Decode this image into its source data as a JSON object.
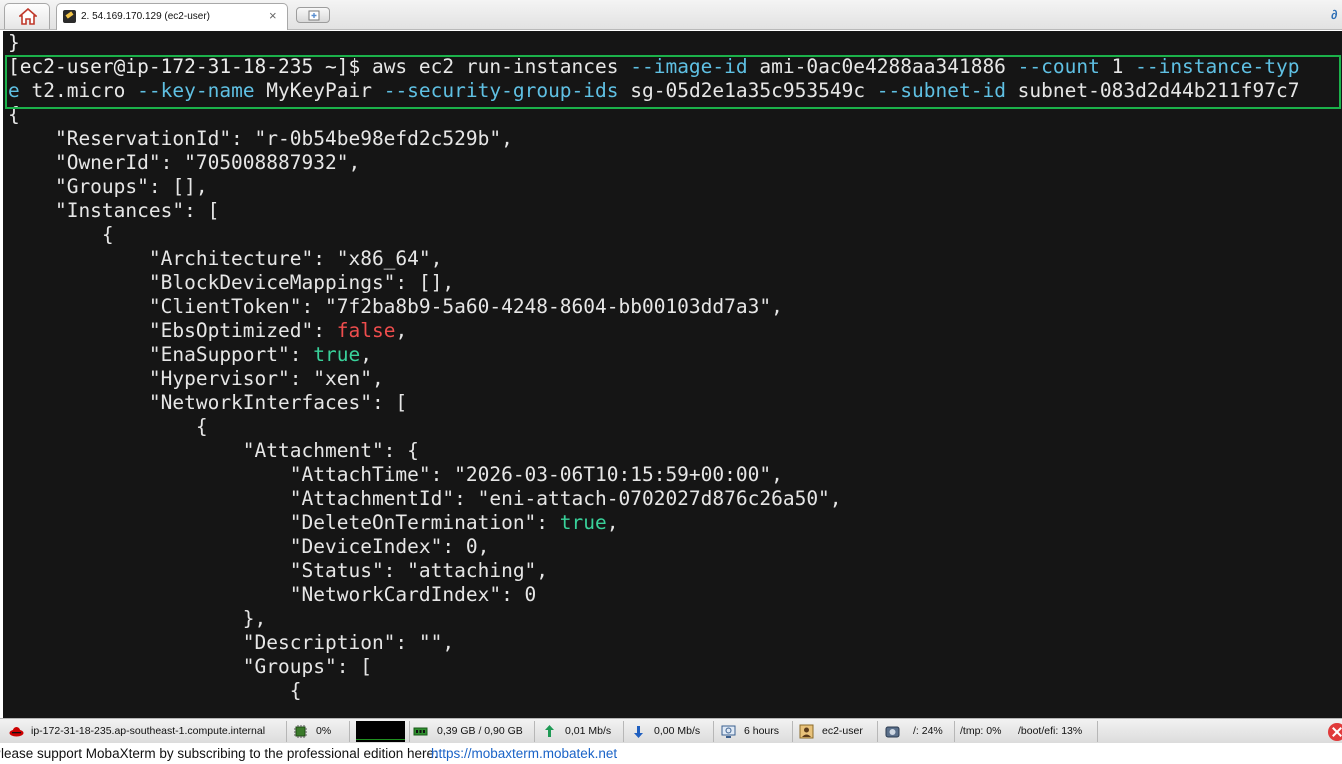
{
  "tabs": {
    "home_icon": "home-icon",
    "session_label": "2. 54.169.170.129 (ec2-user)",
    "close_glyph": "×",
    "new_tab_icon": "add-tab-icon"
  },
  "terminal": {
    "prev_brace": "}",
    "prompt": "[ec2-user@ip-172-31-18-235 ~]$ ",
    "cmd_line1": [
      {
        "text": "aws ec2 run-instances ",
        "kind": "val"
      },
      {
        "text": "--image-id",
        "kind": "flag"
      },
      {
        "text": " ami-0ac0e4288aa341886 ",
        "kind": "val"
      },
      {
        "text": "--count",
        "kind": "flag"
      },
      {
        "text": " 1 ",
        "kind": "val"
      },
      {
        "text": "--instance-typ",
        "kind": "flag"
      }
    ],
    "cmd_line2": [
      {
        "text": "e",
        "kind": "flag"
      },
      {
        "text": " t2.micro ",
        "kind": "val"
      },
      {
        "text": "--key-name",
        "kind": "flag"
      },
      {
        "text": " MyKeyPair ",
        "kind": "val"
      },
      {
        "text": "--security-group-ids",
        "kind": "flag"
      },
      {
        "text": " sg-05d2e1a35c953549c ",
        "kind": "val"
      },
      {
        "text": "--subnet-id",
        "kind": "flag"
      },
      {
        "text": " subnet-083d2d44b211f97c7",
        "kind": "val"
      }
    ],
    "output": [
      [
        {
          "text": "{",
          "kind": "val"
        }
      ],
      [
        {
          "text": "    \"ReservationId\": \"r-0b54be98efd2c529b\",",
          "kind": "val"
        }
      ],
      [
        {
          "text": "    \"OwnerId\": \"705008887932\",",
          "kind": "val"
        }
      ],
      [
        {
          "text": "    \"Groups\": [],",
          "kind": "val"
        }
      ],
      [
        {
          "text": "    \"Instances\": [",
          "kind": "val"
        }
      ],
      [
        {
          "text": "        {",
          "kind": "val"
        }
      ],
      [
        {
          "text": "            \"Architecture\": \"x86_64\",",
          "kind": "val"
        }
      ],
      [
        {
          "text": "            \"BlockDeviceMappings\": [],",
          "kind": "val"
        }
      ],
      [
        {
          "text": "            \"ClientToken\": \"7f2ba8b9-5a60-4248-8604-bb00103dd7a3\",",
          "kind": "val"
        }
      ],
      [
        {
          "text": "            \"EbsOptimized\": ",
          "kind": "val"
        },
        {
          "text": "false",
          "kind": "false"
        },
        {
          "text": ",",
          "kind": "val"
        }
      ],
      [
        {
          "text": "            \"EnaSupport\": ",
          "kind": "val"
        },
        {
          "text": "true",
          "kind": "true"
        },
        {
          "text": ",",
          "kind": "val"
        }
      ],
      [
        {
          "text": "            \"Hypervisor\": \"xen\",",
          "kind": "val"
        }
      ],
      [
        {
          "text": "            \"NetworkInterfaces\": [",
          "kind": "val"
        }
      ],
      [
        {
          "text": "                {",
          "kind": "val"
        }
      ],
      [
        {
          "text": "                    \"Attachment\": {",
          "kind": "val"
        }
      ],
      [
        {
          "text": "                        \"AttachTime\": \"2026-03-06T10:15:59+00:00\",",
          "kind": "val"
        }
      ],
      [
        {
          "text": "                        \"AttachmentId\": \"eni-attach-0702027d876c26a50\",",
          "kind": "val"
        }
      ],
      [
        {
          "text": "                        \"DeleteOnTermination\": ",
          "kind": "val"
        },
        {
          "text": "true",
          "kind": "true"
        },
        {
          "text": ",",
          "kind": "val"
        }
      ],
      [
        {
          "text": "                        \"DeviceIndex\": 0,",
          "kind": "val"
        }
      ],
      [
        {
          "text": "                        \"Status\": \"attaching\",",
          "kind": "val"
        }
      ],
      [
        {
          "text": "                        \"NetworkCardIndex\": 0",
          "kind": "val"
        }
      ],
      [
        {
          "text": "                    },",
          "kind": "val"
        }
      ],
      [
        {
          "text": "                    \"Description\": \"\",",
          "kind": "val"
        }
      ],
      [
        {
          "text": "                    \"Groups\": [",
          "kind": "val"
        }
      ],
      [
        {
          "text": "                        {",
          "kind": "val"
        }
      ]
    ]
  },
  "statusbar": {
    "host": "ip-172-31-18-235.ap-southeast-1.compute.internal",
    "cpu": "0%",
    "memory": "0,39 GB / 0,90 GB",
    "upload": "0,01 Mb/s",
    "download": "0,00 Mb/s",
    "uptime": "6 hours",
    "user": "ec2-user",
    "disk_root": "/: 24%",
    "disk_tmp": "/tmp: 0%",
    "disk_boot": "/boot/efi: 13%"
  },
  "footer": {
    "message": "Please support MobaXterm by subscribing to the professional edition here:",
    "link": "https://mobaxterm.mobatek.net"
  },
  "colors": {
    "terminal_bg": "#151515",
    "flag": "#5fc0e3",
    "false": "#ee4d4d",
    "true": "#39d19a",
    "highlight_border": "#1bb14a"
  }
}
